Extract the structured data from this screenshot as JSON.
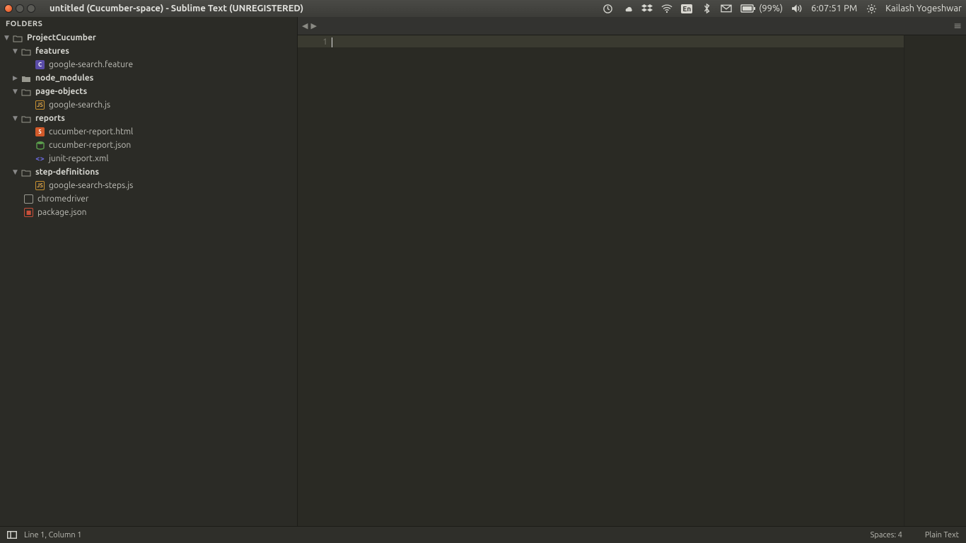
{
  "titlebar": {
    "title": "untitled (Cucumber-space) - Sublime Text (UNREGISTERED)"
  },
  "tray": {
    "language": "En",
    "battery": "(99%)",
    "time": "6:07:51 PM",
    "user": "Kailash Yogeshwar"
  },
  "sidebar": {
    "header": "FOLDERS",
    "tree": {
      "project": "ProjectCucumber",
      "features": "features",
      "features_file": "google-search.feature",
      "node_modules": "node_modules",
      "page_objects": "page-objects",
      "page_objects_file": "google-search.js",
      "reports": "reports",
      "reports_html": "cucumber-report.html",
      "reports_json": "cucumber-report.json",
      "reports_xml": "junit-report.xml",
      "step_defs": "step-definitions",
      "step_defs_file": "google-search-steps.js",
      "chromedriver": "chromedriver",
      "package_json": "package.json"
    }
  },
  "editor": {
    "line_number": "1"
  },
  "statusbar": {
    "position": "Line 1, Column 1",
    "spaces": "Spaces: 4",
    "syntax": "Plain Text"
  }
}
